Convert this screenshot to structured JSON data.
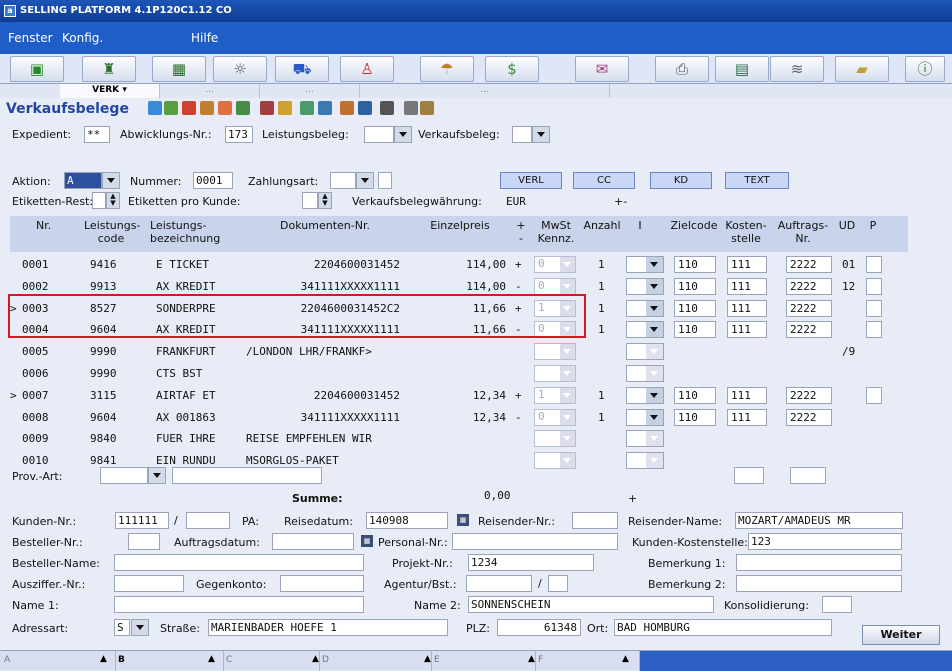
{
  "window": {
    "title": "SELLING PLATFORM 4.1P120C1.12 CO"
  },
  "menu": [
    "Fenster",
    "Konfig.",
    "Hilfe"
  ],
  "toolbar_icons": [
    "cube-icon",
    "person-desk-icon",
    "monitor-icon",
    "sun-icon",
    "car-icon",
    "person-icon",
    "umbrella-icon",
    "money-icon",
    "envelope-icon",
    "printer-icon",
    "document-icon",
    "road-icon",
    "folder-icon",
    "info-icon"
  ],
  "tabs": [
    "VERK",
    "...",
    "...",
    "..."
  ],
  "page": {
    "title": "Verkaufsbelege"
  },
  "form_top": {
    "expedient_label": "Expedient:",
    "expedient_value": "**",
    "abwicklung_label": "Abwicklungs-Nr.:",
    "abwicklung_value": "173",
    "leistungsbeleg_label": "Leistungsbeleg:",
    "verkaufsbeleg_label": "Verkaufsbeleg:",
    "aktion_label": "Aktion:",
    "aktion_value": "A",
    "nummer_label": "Nummer:",
    "nummer_value": "0001",
    "zahlungsart_label": "Zahlungsart:",
    "etiketten_rest_label": "Etiketten-Rest:",
    "etiketten_pro_kunde_label": "Etiketten pro Kunde:",
    "waehrung_label": "Verkaufsbelegwährung:",
    "waehrung_value": "EUR",
    "plusminus": "+-",
    "buttons": [
      "VERL",
      "CC",
      "KD",
      "TEXT"
    ]
  },
  "table": {
    "headers": [
      "Nr.",
      "Leistungs-\ncode",
      "Leistungs-\nbezeichnung",
      "Dokumenten-Nr.",
      "Einzelpreis",
      "+\n-",
      "MwSt\nKennz.",
      "Anzahl",
      "I",
      "Zielcode",
      "Kosten-\nstelle",
      "Auftrags-\nNr.",
      "UD",
      "P"
    ],
    "rows": [
      {
        "marker": "",
        "nr": "0001",
        "code": "9416",
        "bez": "E TICKET",
        "dok": "2204600031452",
        "preis": "114,00",
        "sign": "+",
        "mwst": "0",
        "anzahl": "1",
        "ziel": "110",
        "kosten": "111",
        "auftrag": "2222",
        "ud": "01",
        "p": true
      },
      {
        "marker": "",
        "nr": "0002",
        "code": "9913",
        "bez": "AX KREDIT",
        "dok": "341111XXXXX1111",
        "preis": "114,00",
        "sign": "-",
        "mwst": "0",
        "anzahl": "1",
        "ziel": "110",
        "kosten": "111",
        "auftrag": "2222",
        "ud": "12",
        "p": true
      },
      {
        "marker": ">",
        "nr": "0003",
        "code": "8527",
        "bez": "SONDERPRE",
        "dok": "2204600031452C2",
        "preis": "11,66",
        "sign": "+",
        "mwst": "1",
        "anzahl": "1",
        "ziel": "110",
        "kosten": "111",
        "auftrag": "2222",
        "ud": "",
        "p": true
      },
      {
        "marker": "",
        "nr": "0004",
        "code": "9604",
        "bez": "AX KREDIT",
        "dok": "341111XXXXX1111",
        "preis": "11,66",
        "sign": "-",
        "mwst": "0",
        "anzahl": "1",
        "ziel": "110",
        "kosten": "111",
        "auftrag": "2222",
        "ud": "",
        "p": true
      },
      {
        "marker": "",
        "nr": "0005",
        "code": "9990",
        "bez": "FRANKFURT",
        "dok": "/LONDON LHR/FRANKF>",
        "preis": "",
        "sign": "",
        "mwst": "",
        "anzahl": "",
        "ziel": "",
        "kosten": "",
        "auftrag": "",
        "ud": "/9",
        "p": false
      },
      {
        "marker": "",
        "nr": "0006",
        "code": "9990",
        "bez": "CTS BST",
        "dok": "",
        "preis": "",
        "sign": "",
        "mwst": "",
        "anzahl": "",
        "ziel": "",
        "kosten": "",
        "auftrag": "",
        "ud": "",
        "p": false
      },
      {
        "marker": ">",
        "nr": "0007",
        "code": "3115",
        "bez": "AIRTAF ET",
        "dok": "2204600031452",
        "preis": "12,34",
        "sign": "+",
        "mwst": "1",
        "anzahl": "1",
        "ziel": "110",
        "kosten": "111",
        "auftrag": "2222",
        "ud": "",
        "p": true
      },
      {
        "marker": "",
        "nr": "0008",
        "code": "9604",
        "bez": "AX 001863",
        "dok": "341111XXXXX1111",
        "preis": "12,34",
        "sign": "-",
        "mwst": "0",
        "anzahl": "1",
        "ziel": "110",
        "kosten": "111",
        "auftrag": "2222",
        "ud": "",
        "p": false
      },
      {
        "marker": "",
        "nr": "0009",
        "code": "9840",
        "bez": "FUER IHRE",
        "dok": "REISE EMPFEHLEN WIR",
        "preis": "",
        "sign": "",
        "mwst": "",
        "anzahl": "",
        "ziel": "",
        "kosten": "",
        "auftrag": "",
        "ud": "",
        "p": false
      },
      {
        "marker": "",
        "nr": "0010",
        "code": "9841",
        "bez": "EIN RUNDU",
        "dok": "MSORGLOS-PAKET",
        "preis": "",
        "sign": "",
        "mwst": "",
        "anzahl": "",
        "ziel": "",
        "kosten": "",
        "auftrag": "",
        "ud": "",
        "p": false
      }
    ]
  },
  "bottom": {
    "prov_art_label": "Prov.-Art:",
    "summe_label": "Summe:",
    "summe_value": "0,00",
    "summe_sign": "+",
    "kunden_nr_label": "Kunden-Nr.:",
    "kunden_nr_value": "111111",
    "slash": "/",
    "pa_label": "PA:",
    "reisedatum_label": "Reisedatum:",
    "reisedatum_value": "140908",
    "reisender_nr_label": "Reisender-Nr.:",
    "reisender_name_label": "Reisender-Name:",
    "reisender_name_value": "MOZART/AMADEUS MR",
    "besteller_nr_label": "Besteller-Nr.:",
    "auftragsdatum_label": "Auftragsdatum:",
    "personal_nr_label": "Personal-Nr.:",
    "kunden_kostenstelle_label": "Kunden-Kostenstelle:",
    "kunden_kostenstelle_value": "123",
    "besteller_name_label": "Besteller-Name:",
    "projekt_nr_label": "Projekt-Nr.:",
    "projekt_nr_value": "1234",
    "bemerkung1_label": "Bemerkung 1:",
    "ausziffer_label": "Ausziffer.-Nr.:",
    "gegenkonto_label": "Gegenkonto:",
    "agentur_label": "Agentur/Bst.:",
    "bemerkung2_label": "Bemerkung 2:",
    "name1_label": "Name 1:",
    "name2_label": "Name 2:",
    "name2_value": "SONNENSCHEIN",
    "konsolidierung_label": "Konsolidierung:",
    "adressart_label": "Adressart:",
    "adressart_value": "S",
    "strasse_label": "Straße:",
    "strasse_value": "MARIENBADER HOEFE 1",
    "plz_label": "PLZ:",
    "plz_value": "61348",
    "ort_label": "Ort:",
    "ort_value": "BAD HOMBURG",
    "weiter_label": "Weiter"
  },
  "statusbar": [
    "A",
    "B",
    "C",
    "D",
    "E",
    "F"
  ],
  "colors": {
    "titlebar": "#1d55b8",
    "menubar": "#1f5ec6",
    "highlight": "#d11a22",
    "title": "#2446a3"
  }
}
